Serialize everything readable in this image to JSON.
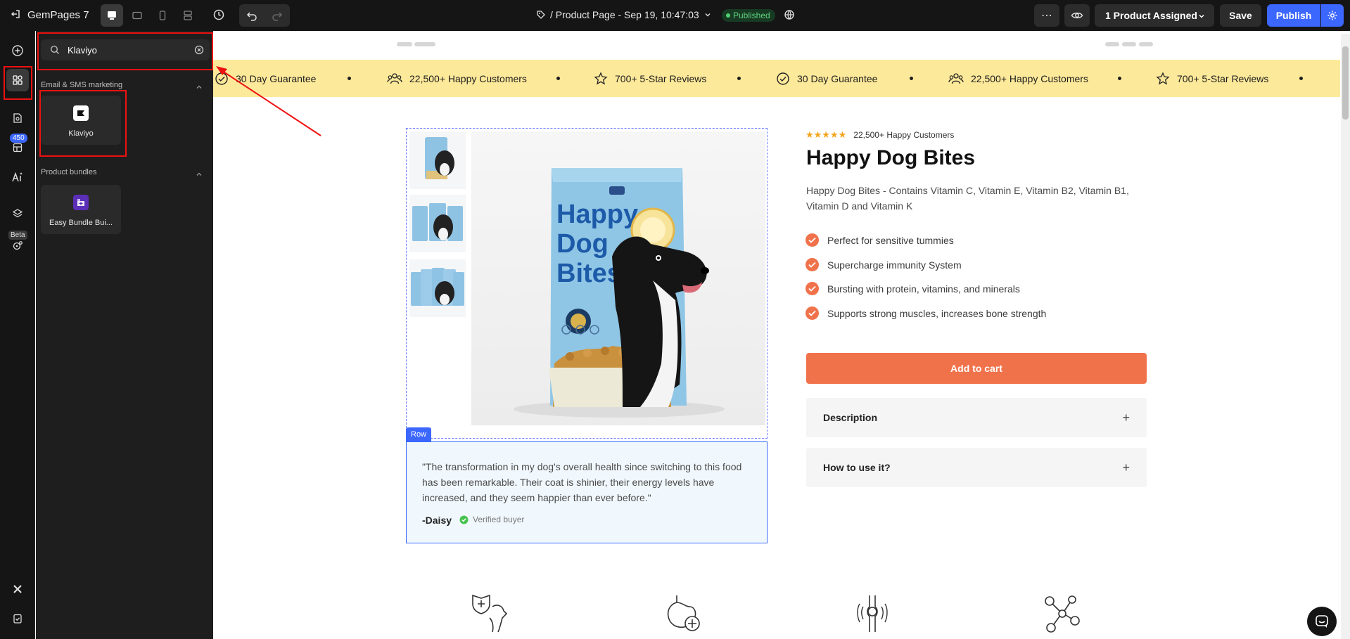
{
  "topbar": {
    "app_title": "GemPages 7",
    "page_label": "/ Product Page - Sep 19, 10:47:03",
    "status": "Published",
    "assigned": "1 Product Assigned",
    "save": "Save",
    "publish": "Publish",
    "more": "⋯"
  },
  "rail": {
    "badge": "450",
    "beta": "Beta"
  },
  "panel": {
    "search_value": "Klaviyo",
    "group1": "Email & SMS marketing",
    "group1_app": "Klaviyo",
    "group2": "Product bundles",
    "group2_app": "Easy Bundle Bui..."
  },
  "marquee": {
    "items": [
      "30 Day Guarantee",
      "22,500+ Happy Customers",
      "700+ 5-Star Reviews",
      "30 Day Guarantee",
      "22,500+ Happy Customers",
      "700+ 5-Star Reviews"
    ]
  },
  "product": {
    "rating_text": "22,500+ Happy Customers",
    "stars": "★★★★★",
    "title": "Happy Dog Bites",
    "description": "Happy Dog Bites - Contains Vitamin C, Vitamin E, Vitamin B2, Vitamin B1, Vitamin D and Vitamin K",
    "features": [
      "Perfect for sensitive tummies",
      "Supercharge immunity System",
      "Bursting with protein, vitamins, and minerals",
      "Supports strong muscles, increases bone strength"
    ],
    "add_to_cart": "Add to cart",
    "accordion": [
      "Description",
      "How to use it?"
    ],
    "bag_text": [
      "Happy",
      "Dog",
      "Bites"
    ]
  },
  "testimonial": {
    "row_tag": "Row",
    "quote": "\"The transformation in my dog's overall health since switching to this food has been remarkable. Their coat is shinier, their energy levels have increased, and they seem happier than ever before.\"",
    "name": "-Daisy",
    "verified": "Verified buyer"
  },
  "colors": {
    "accent": "#f0724b",
    "primary": "#3c67ff",
    "marquee_bg": "#fde99a",
    "annotation": "#e11111"
  }
}
